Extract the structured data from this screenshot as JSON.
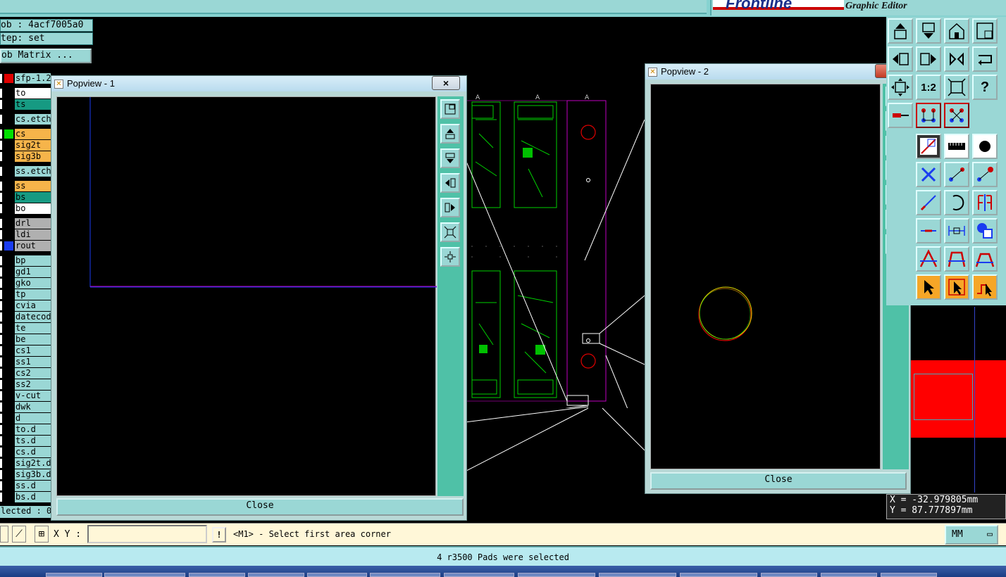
{
  "header": {
    "logo_text": "Frontline",
    "logo_subtitle": "Graphic Editor"
  },
  "job": {
    "job_line": "ob : 4acf7005a0",
    "step_line": "tep: set",
    "matrix_button": "ob Matrix ..."
  },
  "layers": [
    {
      "name": "sfp-1.2",
      "bg": "#9ad7d5",
      "swatch": "#e00000"
    },
    {
      "name": "to",
      "bg": "#ffffff",
      "swatch": "#000000"
    },
    {
      "name": "ts",
      "bg": "#169a82",
      "swatch": "#000000"
    },
    {
      "name": "cs.etch",
      "bg": "#9ad7d5",
      "swatch": "#000000"
    },
    {
      "name": "cs",
      "bg": "#f6b44a",
      "swatch": "#00e000"
    },
    {
      "name": "sig2t",
      "bg": "#f6b44a",
      "swatch": "#000000"
    },
    {
      "name": "sig3b",
      "bg": "#f6b44a",
      "swatch": "#000000"
    },
    {
      "name": "ss.etch",
      "bg": "#9ad7d5",
      "swatch": "#000000"
    },
    {
      "name": "ss",
      "bg": "#f6b44a",
      "swatch": "#000000"
    },
    {
      "name": "bs",
      "bg": "#169a82",
      "swatch": "#000000"
    },
    {
      "name": "bo",
      "bg": "#ffffff",
      "swatch": "#000000"
    },
    {
      "name": "drl",
      "bg": "#b0b0b0",
      "swatch": "#000000"
    },
    {
      "name": "ldi",
      "bg": "#b0b0b0",
      "swatch": "#000000"
    },
    {
      "name": "rout",
      "bg": "#b0b0b0",
      "swatch": "#1a3cf0"
    },
    {
      "name": "bp",
      "bg": "#9ad7d5",
      "swatch": "#000000"
    },
    {
      "name": "gd1",
      "bg": "#9ad7d5",
      "swatch": "#000000"
    },
    {
      "name": "gko",
      "bg": "#9ad7d5",
      "swatch": "#000000"
    },
    {
      "name": "tp",
      "bg": "#9ad7d5",
      "swatch": "#000000"
    },
    {
      "name": "cvia",
      "bg": "#9ad7d5",
      "swatch": "#000000"
    },
    {
      "name": "datecode",
      "bg": "#9ad7d5",
      "swatch": "#000000"
    },
    {
      "name": "te",
      "bg": "#9ad7d5",
      "swatch": "#000000"
    },
    {
      "name": "be",
      "bg": "#9ad7d5",
      "swatch": "#000000"
    },
    {
      "name": "cs1",
      "bg": "#9ad7d5",
      "swatch": "#000000"
    },
    {
      "name": "ss1",
      "bg": "#9ad7d5",
      "swatch": "#000000"
    },
    {
      "name": "cs2",
      "bg": "#9ad7d5",
      "swatch": "#000000"
    },
    {
      "name": "ss2",
      "bg": "#9ad7d5",
      "swatch": "#000000"
    },
    {
      "name": "v-cut",
      "bg": "#9ad7d5",
      "swatch": "#000000"
    },
    {
      "name": "dwk",
      "bg": "#9ad7d5",
      "swatch": "#000000"
    },
    {
      "name": "d",
      "bg": "#9ad7d5",
      "swatch": "#000000"
    },
    {
      "name": "to.d",
      "bg": "#9ad7d5",
      "swatch": "#000000"
    },
    {
      "name": "ts.d",
      "bg": "#9ad7d5",
      "swatch": "#000000"
    },
    {
      "name": "cs.d",
      "bg": "#9ad7d5",
      "swatch": "#000000"
    },
    {
      "name": "sig2t.d",
      "bg": "#9ad7d5",
      "swatch": "#000000"
    },
    {
      "name": "sig3b.d",
      "bg": "#9ad7d5",
      "swatch": "#000000"
    },
    {
      "name": "ss.d",
      "bg": "#9ad7d5",
      "swatch": "#000000"
    },
    {
      "name": "bs.d",
      "bg": "#9ad7d5",
      "swatch": "#000000"
    }
  ],
  "selected_label": "lected : 0",
  "popview1": {
    "title": "Popview - 1",
    "close_label": "Close",
    "close_x": "×"
  },
  "popview2": {
    "title": "Popview - 2",
    "close_label": "Close",
    "close_x": "×"
  },
  "coords": {
    "x_line": "X = -32.979805mm",
    "y_line": "Y = 87.777897mm"
  },
  "command": {
    "xy_label": "X Y :",
    "xy_value": "",
    "bang": "!",
    "prompt": "<M1> - Select first area corner",
    "units": "MM"
  },
  "status": {
    "message": "4 r3500 Pads were selected"
  },
  "toolbar": {
    "scale_label": "1:2",
    "help_label": "?"
  },
  "colors": {
    "panel": "#9ad7d5",
    "side_bar": "#4fc1a7",
    "copper": "#00e000",
    "outline": "#c000c0",
    "pad_red": "#e00000"
  }
}
